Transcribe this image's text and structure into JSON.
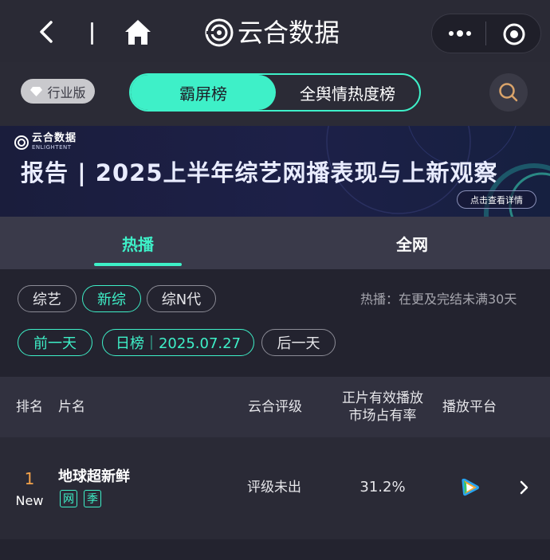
{
  "nav": {
    "title": "云合数据"
  },
  "header": {
    "edition_label": "行业版",
    "segments": [
      {
        "label": "霸屏榜",
        "active": true
      },
      {
        "label": "全舆情热度榜",
        "active": false
      }
    ]
  },
  "banner": {
    "brand": "云合数据",
    "brand_en": "ENLIGHTENT",
    "title": "报告 | 2025上半年综艺网播表现与上新观察",
    "link": "点击查看详情"
  },
  "tabs": [
    {
      "label": "热播",
      "active": true
    },
    {
      "label": "全网",
      "active": false
    }
  ],
  "filters": {
    "categories": [
      {
        "label": "综艺",
        "active": false
      },
      {
        "label": "新综",
        "active": true
      },
      {
        "label": "综N代",
        "active": false
      }
    ],
    "hint": "热播：在更及完结未满30天",
    "prev_day": "前一天",
    "date_label": "日榜｜2025.07.27",
    "next_day": "后一天"
  },
  "table": {
    "columns": {
      "rank": "排名",
      "name": "片名",
      "rating": "云合评级",
      "share_line1": "正片有效播放",
      "share_line2": "市场占有率",
      "platform": "播放平台"
    },
    "rows": [
      {
        "rank": "1",
        "rank_status": "New",
        "title": "地球超新鲜",
        "tags": [
          "网",
          "季"
        ],
        "rating": "评级未出",
        "share": "31.2%",
        "platform": "tencent-video-icon"
      }
    ]
  },
  "colors": {
    "accent": "#3ef0c8",
    "rank": "#f4a24a",
    "background": "#23232f"
  }
}
